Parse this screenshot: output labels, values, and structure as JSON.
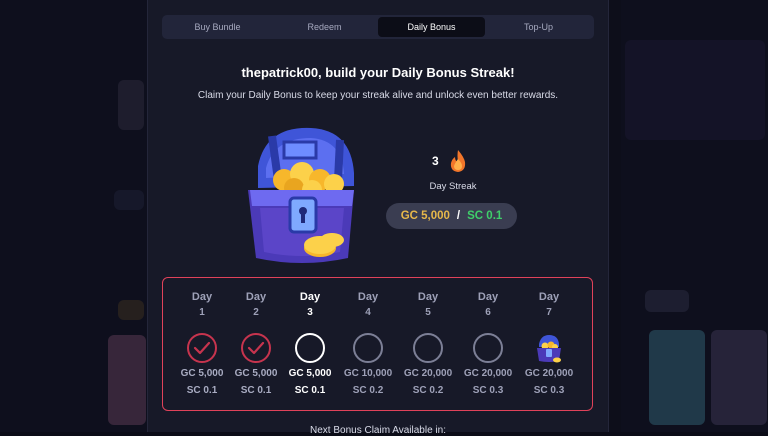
{
  "tabs": [
    {
      "label": "Buy Bundle",
      "active": false
    },
    {
      "label": "Redeem",
      "active": false
    },
    {
      "label": "Daily Bonus",
      "active": true
    },
    {
      "label": "Top-Up",
      "active": false
    }
  ],
  "header": {
    "title": "thepatrick00, build your Daily Bonus Streak!",
    "subtitle": "Claim your Daily Bonus to keep your streak alive and unlock even better rewards."
  },
  "streak": {
    "count": "3",
    "label": "Day Streak",
    "icon": "fire-icon",
    "reward_gc": "GC 5,000",
    "reward_separator": "/",
    "reward_sc": "SC 0.1"
  },
  "days": [
    {
      "label": "Day",
      "num": "1",
      "gc": "GC 5,000",
      "sc": "SC 0.1",
      "status": "claimed"
    },
    {
      "label": "Day",
      "num": "2",
      "gc": "GC 5,000",
      "sc": "SC 0.1",
      "status": "claimed"
    },
    {
      "label": "Day",
      "num": "3",
      "gc": "GC 5,000",
      "sc": "SC 0.1",
      "status": "current"
    },
    {
      "label": "Day",
      "num": "4",
      "gc": "GC 10,000",
      "sc": "SC 0.2",
      "status": "locked"
    },
    {
      "label": "Day",
      "num": "5",
      "gc": "GC 20,000",
      "sc": "SC 0.2",
      "status": "locked"
    },
    {
      "label": "Day",
      "num": "6",
      "gc": "GC 20,000",
      "sc": "SC 0.3",
      "status": "locked"
    },
    {
      "label": "Day",
      "num": "7",
      "gc": "GC 20,000",
      "sc": "SC 0.3",
      "status": "chest"
    }
  ],
  "footer": {
    "next_claim_label": "Next Bonus Claim Available in:"
  },
  "colors": {
    "accent_red": "#e0425a",
    "gc_gold": "#e7b84a",
    "sc_green": "#3fcf6a"
  }
}
